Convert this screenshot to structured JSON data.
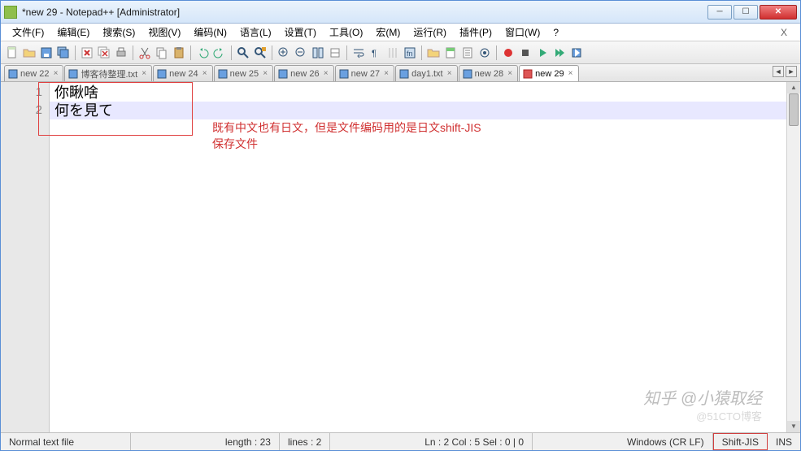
{
  "title": "*new 29 - Notepad++ [Administrator]",
  "menus": [
    "文件(F)",
    "编辑(E)",
    "搜索(S)",
    "视图(V)",
    "编码(N)",
    "语言(L)",
    "设置(T)",
    "工具(O)",
    "宏(M)",
    "运行(R)",
    "插件(P)",
    "窗口(W)",
    "?"
  ],
  "tabs": [
    {
      "label": "new 22",
      "active": false,
      "dirty": false
    },
    {
      "label": "博客待整理.txt",
      "active": false,
      "dirty": false
    },
    {
      "label": "new 24",
      "active": false,
      "dirty": false
    },
    {
      "label": "new 25",
      "active": false,
      "dirty": false
    },
    {
      "label": "new 26",
      "active": false,
      "dirty": false
    },
    {
      "label": "new 27",
      "active": false,
      "dirty": false
    },
    {
      "label": "day1.txt",
      "active": false,
      "dirty": false
    },
    {
      "label": "new 28",
      "active": false,
      "dirty": false
    },
    {
      "label": "new 29",
      "active": true,
      "dirty": true
    }
  ],
  "lines": [
    "你瞅啥",
    "何を見て"
  ],
  "line_numbers": [
    "1",
    "2"
  ],
  "current_line": 2,
  "annotation": {
    "l1": "既有中文也有日文，但是文件编码用的是日文shift-JIS",
    "l2": "保存文件"
  },
  "status": {
    "filetype": "Normal text file",
    "length": "length : 23",
    "lines": "lines : 2",
    "pos": "Ln : 2    Col : 5    Sel : 0 | 0",
    "eol": "Windows (CR LF)",
    "enc": "Shift-JIS",
    "mode": "INS"
  },
  "watermark": "知乎 @小猿取经",
  "watermark2": "@51CTO博客"
}
